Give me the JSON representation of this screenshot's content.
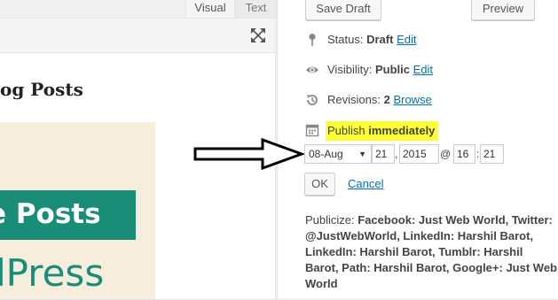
{
  "editor": {
    "tabs": [
      {
        "label": "Visual"
      },
      {
        "label": "Text"
      }
    ],
    "heading_visible": "og Posts",
    "image": {
      "banner_text": "e Posts",
      "wordpress_text": "dPress"
    }
  },
  "publish": {
    "save_draft_label": "Save Draft",
    "preview_label": "Preview",
    "status": {
      "label": "Status:",
      "value": "Draft",
      "edit": "Edit"
    },
    "visibility": {
      "label": "Visibility:",
      "value": "Public",
      "edit": "Edit"
    },
    "revisions": {
      "label": "Revisions:",
      "value": "2",
      "browse": "Browse"
    },
    "publish_when": {
      "label": "Publish",
      "value": "immediately",
      "highlight_color": "#ffff33"
    },
    "date": {
      "month": "08-Aug",
      "day": "21",
      "year": "2015",
      "at": "@",
      "hour": "16",
      "minute": "21",
      "comma": ",",
      "colon": ":"
    },
    "ok_label": "OK",
    "cancel_label": "Cancel",
    "publicize_label": "Publicize:",
    "publicize_text": "Facebook: Just Web World, Twitter: @JustWebWorld, LinkedIn: Harshil Barot, LinkedIn: Harshil Barot, Tumblr: Harshil Barot, Path: Harshil Barot, Google+: Just Web World"
  },
  "colors": {
    "link": "#0073aa",
    "banner": "#1a8d78",
    "image_bg": "#f6eddc"
  },
  "icons": [
    "fullscreen-icon",
    "pin-icon",
    "eye-icon",
    "revisions-icon",
    "calendar-icon",
    "arrow-annotation-icon"
  ]
}
